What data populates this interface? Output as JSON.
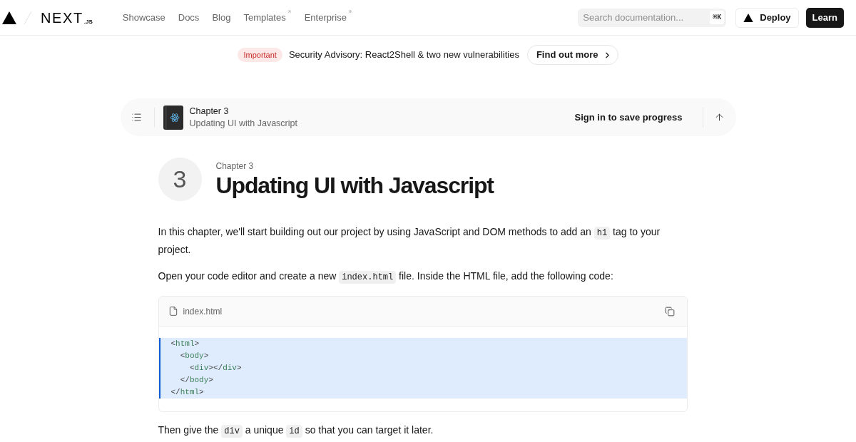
{
  "header": {
    "logo": {
      "wordmark": "NEXT",
      "suffix": ".JS"
    },
    "nav": [
      {
        "label": "Showcase",
        "external": false
      },
      {
        "label": "Docs",
        "external": false
      },
      {
        "label": "Blog",
        "external": false
      },
      {
        "label": "Templates",
        "external": true
      },
      {
        "label": "Enterprise",
        "external": true
      }
    ],
    "search": {
      "placeholder": "Search documentation...",
      "shortcut": "⌘K"
    },
    "buttons": [
      {
        "label": "Deploy",
        "kind": "outline"
      },
      {
        "label": "Learn",
        "kind": "primary"
      }
    ]
  },
  "banner": {
    "badge": "Important",
    "text": "Security Advisory: React2Shell & two new vulnerabilities",
    "link": "Find out more"
  },
  "chapter_bar": {
    "eyebrow": "Chapter 3",
    "title": "Updating UI with Javascript",
    "action": "Sign in to save progress"
  },
  "chapter_heading": {
    "number": "3",
    "eyebrow": "Chapter 3",
    "title": "Updating UI with Javascript"
  },
  "content": [
    {
      "kind": "paragraph",
      "parts": [
        {
          "kind": "text",
          "text": "In this chapter, we'll start building out our project by using JavaScript and DOM methods to add an "
        },
        {
          "kind": "code",
          "text": "h1"
        },
        {
          "kind": "text",
          "text": " tag to your project."
        }
      ]
    },
    {
      "kind": "paragraph",
      "parts": [
        {
          "kind": "text",
          "text": "Open your code editor and create a new "
        },
        {
          "kind": "code",
          "text": "index.html"
        },
        {
          "kind": "text",
          "text": " file. Inside the HTML file, add the following code:"
        }
      ]
    },
    {
      "kind": "code_block",
      "filename": "index.html",
      "lines": [
        {
          "highlighted": true,
          "tokens": [
            {
              "kind": "punct",
              "text": "<"
            },
            {
              "kind": "tag",
              "text": "html"
            },
            {
              "kind": "punct",
              "text": ">"
            }
          ]
        },
        {
          "highlighted": true,
          "tokens": [
            {
              "kind": "punct",
              "text": "  <"
            },
            {
              "kind": "tag",
              "text": "body"
            },
            {
              "kind": "punct",
              "text": ">"
            }
          ]
        },
        {
          "highlighted": true,
          "tokens": [
            {
              "kind": "punct",
              "text": "    <"
            },
            {
              "kind": "tag",
              "text": "div"
            },
            {
              "kind": "punct",
              "text": "></"
            },
            {
              "kind": "tag",
              "text": "div"
            },
            {
              "kind": "punct",
              "text": ">"
            }
          ]
        },
        {
          "highlighted": true,
          "tokens": [
            {
              "kind": "punct",
              "text": "  </"
            },
            {
              "kind": "tag",
              "text": "body"
            },
            {
              "kind": "punct",
              "text": ">"
            }
          ]
        },
        {
          "highlighted": true,
          "tokens": [
            {
              "kind": "punct",
              "text": "</"
            },
            {
              "kind": "tag",
              "text": "html"
            },
            {
              "kind": "punct",
              "text": ">"
            }
          ]
        }
      ]
    },
    {
      "kind": "paragraph",
      "parts": [
        {
          "kind": "text",
          "text": "Then give the "
        },
        {
          "kind": "code",
          "text": "div"
        },
        {
          "kind": "text",
          "text": " a unique "
        },
        {
          "kind": "code",
          "text": "id"
        },
        {
          "kind": "text",
          "text": " so that you can target it later."
        }
      ]
    }
  ]
}
